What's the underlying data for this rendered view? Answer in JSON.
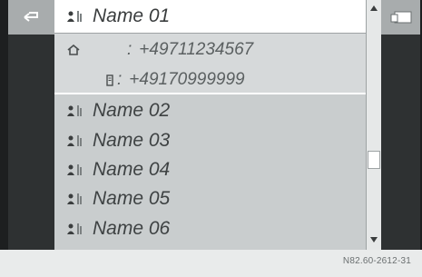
{
  "contacts": {
    "selected": {
      "name": "Name 01"
    },
    "details": {
      "home_separator": ":",
      "home_number": "+49711234567",
      "mobile_separator": ":",
      "mobile_number": "+49170999999"
    },
    "items": [
      {
        "name": "Name 02"
      },
      {
        "name": "Name 03"
      },
      {
        "name": "Name 04"
      },
      {
        "name": "Name 05"
      },
      {
        "name": "Name 06"
      }
    ]
  },
  "icons": {
    "back": "back-arrow-icon",
    "right": "phone-menu-icon",
    "contact": "person-contact-icon",
    "home": "home-icon",
    "mobile": "mobile-phone-icon"
  },
  "colors": {
    "screen_bg": "#1d1f20",
    "list_bg": "#c9cdce",
    "selected_bg": "#ffffff",
    "text": "#3e4243"
  },
  "footer": {
    "code": "N82.60-2612-31"
  }
}
